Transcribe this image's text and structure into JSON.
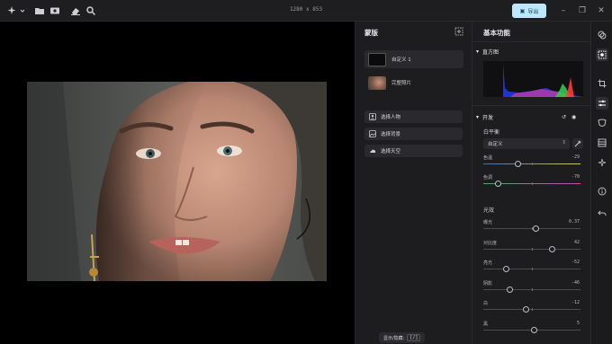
{
  "toolbar": {
    "dimensions": "1280 x 853",
    "export_label": "导出"
  },
  "mask_panel": {
    "title": "蒙版",
    "items": [
      {
        "label": "自定义 1"
      },
      {
        "label": "完整照片"
      }
    ],
    "buttons": [
      {
        "label": "选择人物",
        "icon": "person-icon"
      },
      {
        "label": "选择背景",
        "icon": "background-icon"
      },
      {
        "label": "选择天空",
        "icon": "sky-icon"
      }
    ],
    "shortcut_hint": {
      "label": "显示/隐藏:",
      "key": "[/]"
    }
  },
  "adjust_panel": {
    "title": "基本功能",
    "histogram": {
      "label": "直方图"
    },
    "develop": {
      "label": "开发",
      "white_balance": {
        "label": "白平衡",
        "preset": "自定义",
        "sliders": [
          {
            "label": "色温",
            "value": "-29",
            "level": 0.355
          },
          {
            "label": "色调",
            "value": "-70",
            "level": 0.15
          }
        ]
      },
      "light": {
        "label": "光效",
        "sliders": [
          {
            "label": "曝光",
            "value": "0.37",
            "level": 0.54
          },
          {
            "label": "对比度",
            "value": "42",
            "level": 0.71
          },
          {
            "label": "亮光",
            "value": "-52",
            "level": 0.24
          },
          {
            "label": "阴影",
            "value": "-46",
            "level": 0.27
          },
          {
            "label": "白",
            "value": "-12",
            "level": 0.44
          },
          {
            "label": "黑",
            "value": "5",
            "level": 0.525
          }
        ]
      }
    }
  },
  "colors": {
    "accent": "#bfe6ff",
    "panel_bg": "#1d1d20"
  }
}
